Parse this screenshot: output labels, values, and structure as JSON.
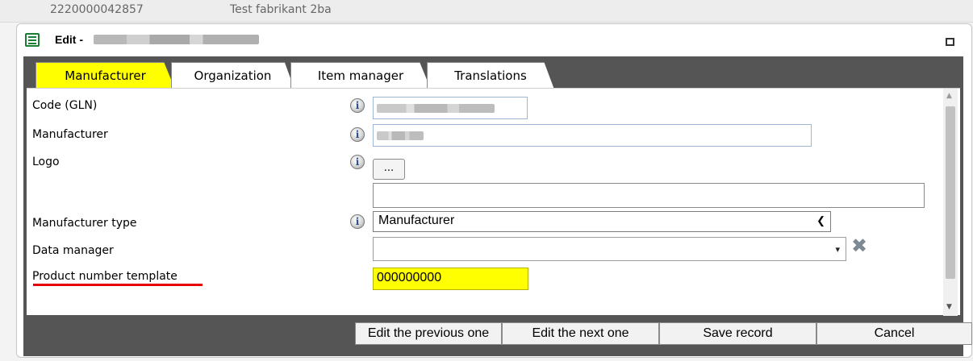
{
  "background_row": {
    "code": "2220000042857",
    "name": "Test fabrikant 2ba"
  },
  "dialog": {
    "title_prefix": "Edit -",
    "tabs": [
      {
        "label": "Manufacturer",
        "active": true
      },
      {
        "label": "Organization",
        "active": false
      },
      {
        "label": "Item manager",
        "active": false
      },
      {
        "label": "Translations",
        "active": false
      }
    ],
    "fields": {
      "code_label": "Code (GLN)",
      "manufacturer_label": "Manufacturer",
      "logo_label": "Logo",
      "logo_button": "...",
      "manufacturer_type_label": "Manufacturer type",
      "manufacturer_type_value": "Manufacturer",
      "data_manager_label": "Data manager",
      "data_manager_value": "",
      "product_number_template_label": "Product number template",
      "product_number_template_value": "000000000"
    },
    "icons": {
      "info": "i",
      "select_arrow": "▾",
      "clear": "✖"
    },
    "buttons": {
      "previous": "Edit the previous one",
      "next": "Edit the next one",
      "save": "Save record",
      "cancel": "Cancel"
    },
    "colors": {
      "active_tab": "#ffff00",
      "highlight_field": "#ffff00",
      "frame": "#555555",
      "underline": "#e60000"
    }
  }
}
